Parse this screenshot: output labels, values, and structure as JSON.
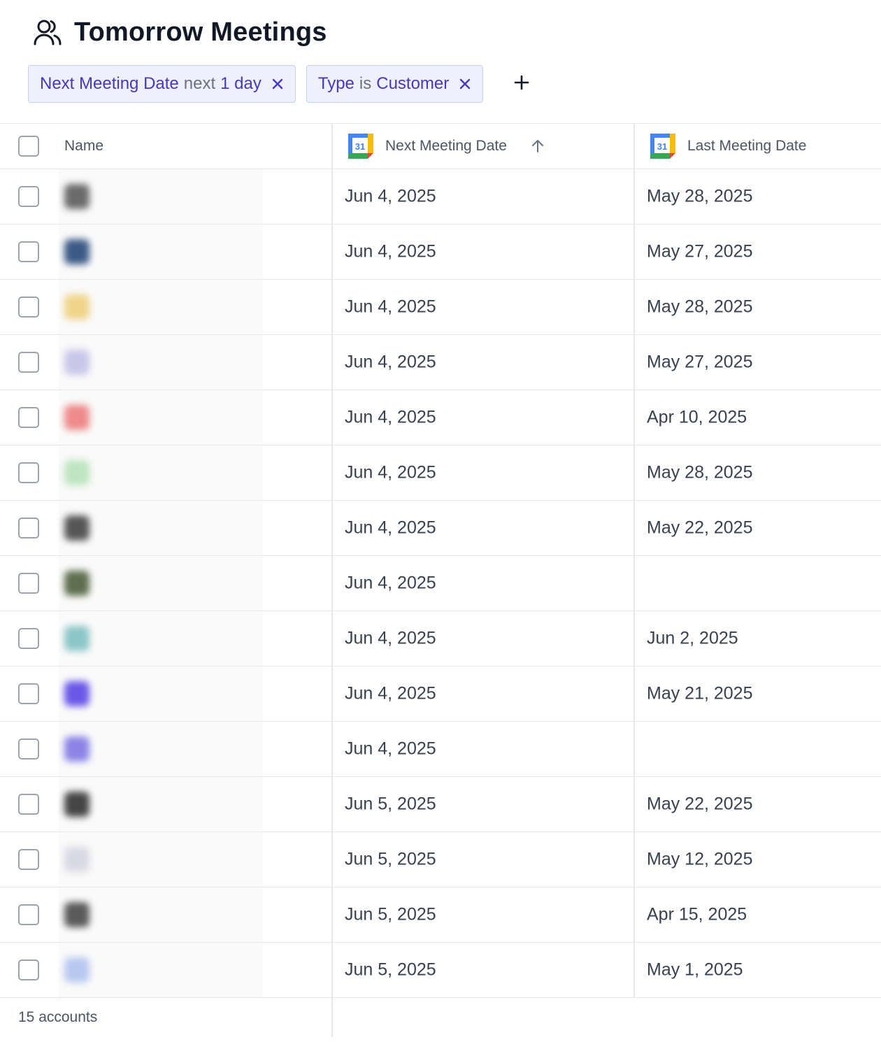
{
  "header": {
    "title": "Tomorrow Meetings",
    "icon": "people-icon"
  },
  "filters": [
    {
      "field": "Next Meeting Date",
      "op": "next",
      "value": "1 day"
    },
    {
      "field": "Type",
      "op": "is",
      "value": "Customer"
    }
  ],
  "table": {
    "columns": {
      "name": "Name",
      "next": "Next Meeting Date",
      "last": "Last Meeting Date"
    },
    "sort": "ascending",
    "rows": [
      {
        "next": "Jun 4, 2025",
        "last": "May 28, 2025",
        "avatar_color": "#6b6b6b"
      },
      {
        "next": "Jun 4, 2025",
        "last": "May 27, 2025",
        "avatar_color": "#3c5a86"
      },
      {
        "next": "Jun 4, 2025",
        "last": "May 28, 2025",
        "avatar_color": "#f0d48a"
      },
      {
        "next": "Jun 4, 2025",
        "last": "May 27, 2025",
        "avatar_color": "#c9c6ea"
      },
      {
        "next": "Jun 4, 2025",
        "last": "Apr 10, 2025",
        "avatar_color": "#ee8a8a"
      },
      {
        "next": "Jun 4, 2025",
        "last": "May 28, 2025",
        "avatar_color": "#bde5bf"
      },
      {
        "next": "Jun 4, 2025",
        "last": "May 22, 2025",
        "avatar_color": "#565656"
      },
      {
        "next": "Jun 4, 2025",
        "last": "",
        "avatar_color": "#5e6e4e"
      },
      {
        "next": "Jun 4, 2025",
        "last": "Jun 2, 2025",
        "avatar_color": "#8cc6c8"
      },
      {
        "next": "Jun 4, 2025",
        "last": "May 21, 2025",
        "avatar_color": "#6b58e8"
      },
      {
        "next": "Jun 4, 2025",
        "last": "",
        "avatar_color": "#8b84e6"
      },
      {
        "next": "Jun 5, 2025",
        "last": "May 22, 2025",
        "avatar_color": "#454545"
      },
      {
        "next": "Jun 5, 2025",
        "last": "May 12, 2025",
        "avatar_color": "#d9d9e4"
      },
      {
        "next": "Jun 5, 2025",
        "last": "Apr 15, 2025",
        "avatar_color": "#5a5a5a"
      },
      {
        "next": "Jun 5, 2025",
        "last": "May 1, 2025",
        "avatar_color": "#b8c8f0"
      }
    ],
    "footer": "15 accounts"
  },
  "colors": {
    "chip_bg": "#eef0fc",
    "chip_border": "#c7cdf4",
    "chip_text": "#4338ca",
    "calendar_blue": "#4285f4",
    "calendar_green": "#34a853",
    "calendar_yellow": "#fbbc04",
    "calendar_red": "#ea4335"
  }
}
